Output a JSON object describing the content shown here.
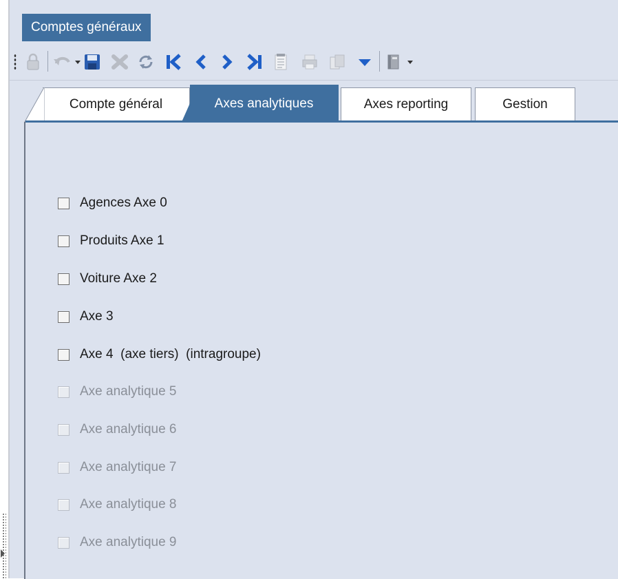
{
  "document_tab": {
    "label": "Comptes généraux"
  },
  "toolbar": {
    "buttons": [
      {
        "name": "lock-icon"
      },
      {
        "name": "undo-icon"
      },
      {
        "name": "save-icon"
      },
      {
        "name": "delete-icon"
      },
      {
        "name": "refresh-icon"
      },
      {
        "name": "first-record-icon"
      },
      {
        "name": "previous-record-icon"
      },
      {
        "name": "next-record-icon"
      },
      {
        "name": "last-record-icon"
      },
      {
        "name": "notes-icon"
      },
      {
        "name": "print-icon"
      },
      {
        "name": "copy-icon"
      },
      {
        "name": "filter-icon"
      },
      {
        "name": "book-icon"
      }
    ],
    "colors": {
      "accent_blue": "#1f5fc7",
      "disabled_gray": "#b8bcc4",
      "save_blue": "#2a5db0"
    }
  },
  "tabs": [
    {
      "label": "Compte général",
      "active": false
    },
    {
      "label": "Axes analytiques",
      "active": true
    },
    {
      "label": "Axes reporting",
      "active": false
    },
    {
      "label": "Gestion",
      "active": false
    }
  ],
  "checkboxes": [
    {
      "label": "Agences Axe 0",
      "checked": false,
      "enabled": true
    },
    {
      "label": "Produits Axe 1",
      "checked": false,
      "enabled": true
    },
    {
      "label": "Voiture Axe 2",
      "checked": false,
      "enabled": true
    },
    {
      "label": "Axe 3",
      "checked": false,
      "enabled": true
    },
    {
      "label": "Axe 4  (axe tiers)  (intragroupe)",
      "checked": false,
      "enabled": true
    },
    {
      "label": "Axe analytique 5",
      "checked": false,
      "enabled": false
    },
    {
      "label": "Axe analytique 6",
      "checked": false,
      "enabled": false
    },
    {
      "label": "Axe analytique 7",
      "checked": false,
      "enabled": false
    },
    {
      "label": "Axe analytique 8",
      "checked": false,
      "enabled": false
    },
    {
      "label": "Axe analytique 9",
      "checked": false,
      "enabled": false
    }
  ],
  "colors": {
    "tab_active": "#3f6f9f",
    "panel_bg": "#dce2ee"
  }
}
